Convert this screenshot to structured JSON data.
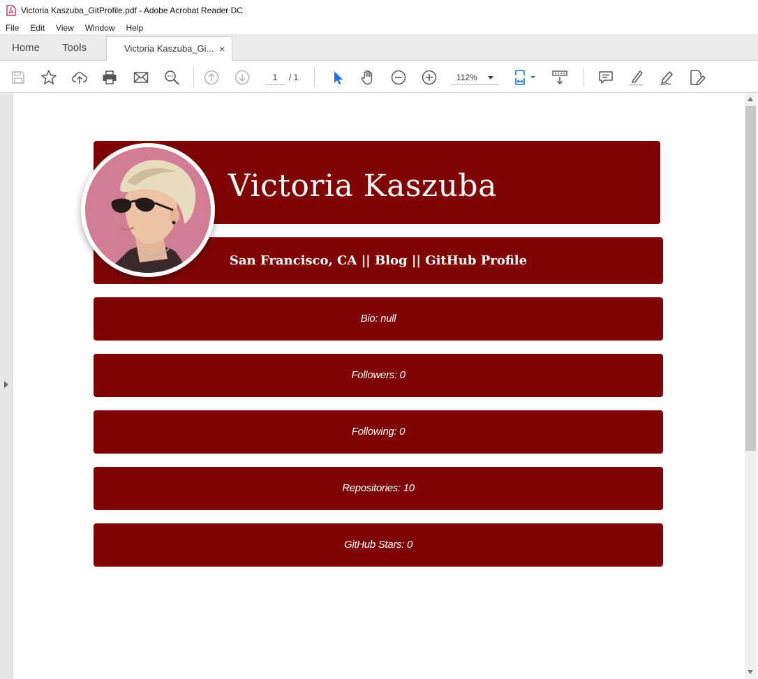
{
  "window": {
    "title": "Victoria Kaszuba_GitProfile.pdf - Adobe Acrobat Reader DC"
  },
  "menu": {
    "items": [
      "File",
      "Edit",
      "View",
      "Window",
      "Help"
    ]
  },
  "tabs": {
    "home": "Home",
    "tools": "Tools",
    "document": "Victoria Kaszuba_Gi...",
    "close": "×"
  },
  "toolbar": {
    "page_current": "1",
    "page_total": "/ 1",
    "zoom": "112%",
    "icons": [
      "save-icon",
      "bookmark-star-icon",
      "upload-cloud-icon",
      "print-icon",
      "email-icon",
      "find-icon",
      "previous-page-icon",
      "next-page-icon",
      "select-arrow-icon",
      "hand-tool-icon",
      "zoom-out-icon",
      "zoom-in-icon",
      "page-fit-icon",
      "scroll-mode-icon",
      "comment-icon",
      "highlight-icon",
      "sign-icon",
      "fill-sign-icon"
    ],
    "accent": "#1473e6"
  },
  "profile": {
    "name": "Victoria Kaszuba",
    "links": "San Francisco, CA || Blog || GitHub Profile",
    "stats": {
      "bio": "Bio: null",
      "followers": "Followers: 0",
      "following": "Following: 0",
      "repositories": "Repositories: 10",
      "stars": "GitHub Stars: 0"
    },
    "theme_color": "#810404"
  }
}
